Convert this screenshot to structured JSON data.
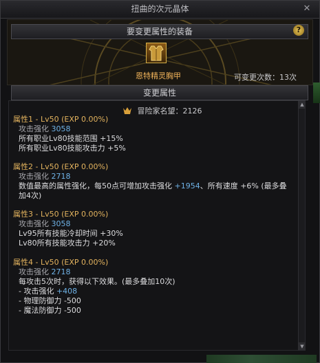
{
  "window": {
    "title": "扭曲的次元晶体",
    "close_symbol": "✕"
  },
  "header": {
    "title": "要变更属性的装备",
    "help_symbol": "?"
  },
  "item": {
    "name": "恩特精灵胸甲",
    "remaining_label": "可变更次数：13次"
  },
  "section": {
    "title": "变更属性"
  },
  "fame": {
    "label": "冒险家名望：2126"
  },
  "attributes": [
    {
      "title": "属性1 - Lv50 (EXP 0.00%)",
      "sub_label": "攻击强化",
      "sub_value": "3058",
      "lines": [
        "所有职业Lv80技能范围 +15%",
        "所有职业Lv80技能攻击力 +5%"
      ]
    },
    {
      "title": "属性2 - Lv50 (EXP 0.00%)",
      "sub_label": "攻击强化",
      "sub_value": "2718",
      "line_a": "数值最高的属性强化，每50点可增加攻击强化 ",
      "line_a_hl": "+1954",
      "line_a_end": "、所有速度 +6% (最多叠",
      "line_b": "加4次)"
    },
    {
      "title": "属性3 - Lv50 (EXP 0.00%)",
      "sub_label": "攻击强化",
      "sub_value": "3058",
      "lines": [
        "Lv95所有技能冷却时间 +30%",
        "Lv80所有技能攻击力 +20%"
      ]
    },
    {
      "title": "属性4 - Lv50 (EXP 0.00%)",
      "sub_label": "攻击强化",
      "sub_value": "2718",
      "line_a": "每攻击5次时，获得以下效果。(最多叠加10次)",
      "line_b_label": "- 攻击强化 ",
      "line_b_hl": "+408",
      "lines": [
        "- 物理防御力 -500",
        "- 魔法防御力 -500"
      ]
    }
  ],
  "scroll": {
    "up": "▲",
    "down": "▼"
  }
}
